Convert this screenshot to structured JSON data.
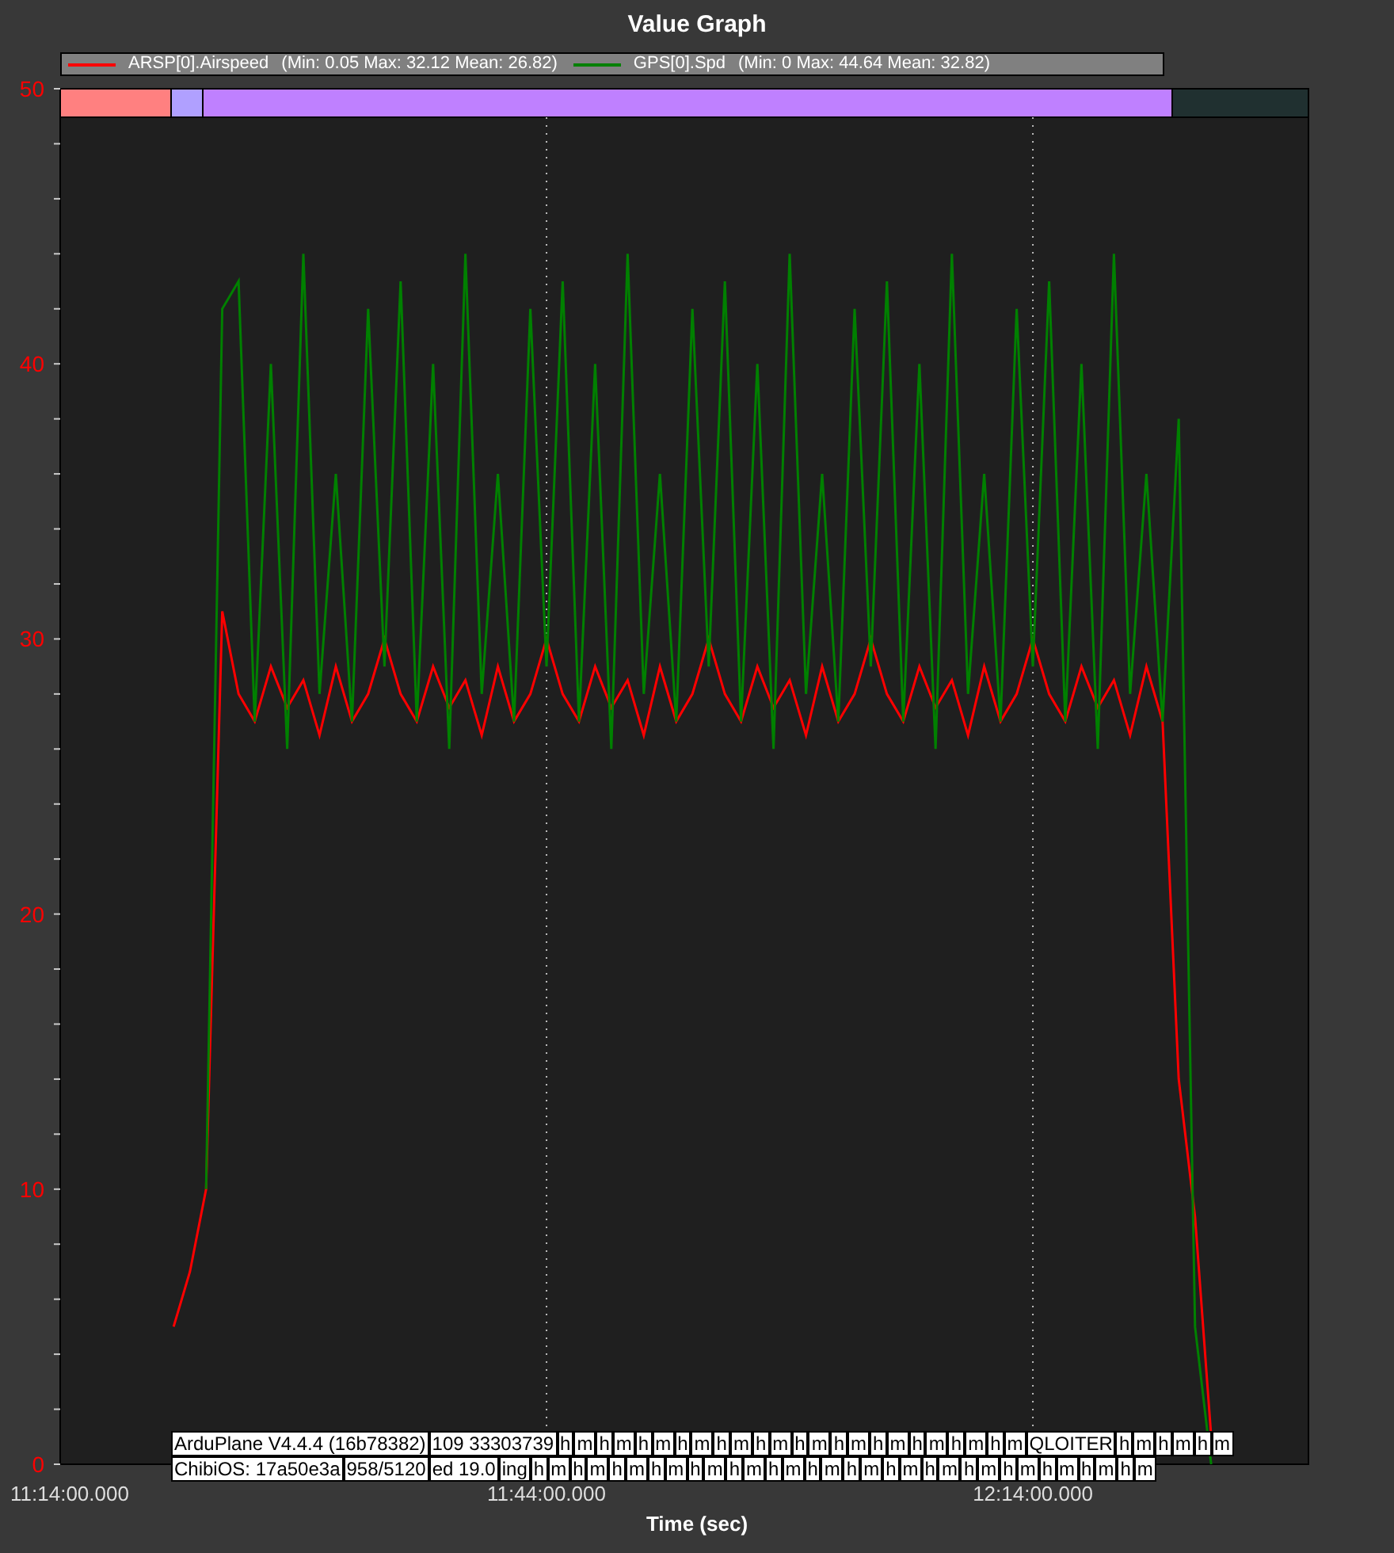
{
  "title": "Value Graph",
  "legend": [
    {
      "stats": "(Min: 0.05 Max: 32.12 Mean: 26.82)"
    },
    {
      "stats": "(Min: 0 Max: 44.64 Mean: 32.82)"
    }
  ],
  "chart_data": {
    "type": "line",
    "xlabel": "Time (sec)",
    "ylim": [
      0,
      50
    ],
    "yticks": [
      0,
      10,
      20,
      30,
      40,
      50
    ],
    "categories": [
      "11:14:00.000",
      null,
      null,
      null,
      null,
      null,
      null,
      null,
      null,
      null,
      null,
      null,
      null,
      null,
      null,
      null,
      null,
      null,
      null,
      null,
      null,
      null,
      null,
      null,
      null,
      null,
      null,
      null,
      null,
      null,
      "11:44:00.000",
      null,
      null,
      null,
      null,
      null,
      null,
      null,
      null,
      null,
      null,
      null,
      null,
      null,
      null,
      null,
      null,
      null,
      null,
      null,
      null,
      null,
      null,
      null,
      null,
      null,
      null,
      null,
      null,
      null,
      "12:14:00.000",
      null,
      null,
      null,
      null,
      null,
      null,
      null,
      null,
      null,
      null,
      null,
      null,
      null,
      null,
      null,
      null,
      null
    ],
    "series": [
      {
        "name": "ARSP[0].Airspeed",
        "color": "#ff0000",
        "values": [
          null,
          null,
          null,
          null,
          null,
          null,
          null,
          5,
          7,
          10,
          31,
          28,
          27,
          29,
          27.5,
          28.5,
          26.5,
          29,
          27,
          28,
          30,
          28,
          27,
          29,
          27.5,
          28.5,
          26.5,
          29,
          27,
          28,
          30,
          28,
          27,
          29,
          27.5,
          28.5,
          26.5,
          29,
          27,
          28,
          30,
          28,
          27,
          29,
          27.5,
          28.5,
          26.5,
          29,
          27,
          28,
          30,
          28,
          27,
          29,
          27.5,
          28.5,
          26.5,
          29,
          27,
          28,
          30,
          28,
          27,
          29,
          27.5,
          28.5,
          26.5,
          29,
          27,
          14,
          9,
          1,
          null,
          null,
          null,
          null,
          null,
          null
        ]
      },
      {
        "name": "GPS[0].Spd",
        "color": "#008000",
        "values": [
          null,
          null,
          null,
          null,
          null,
          null,
          null,
          null,
          null,
          10,
          42,
          43,
          27,
          40,
          26,
          44,
          28,
          36,
          27,
          42,
          29,
          43,
          27,
          40,
          26,
          44,
          28,
          36,
          27,
          42,
          29,
          43,
          27,
          40,
          26,
          44,
          28,
          36,
          27,
          42,
          29,
          43,
          27,
          40,
          26,
          44,
          28,
          36,
          27,
          42,
          29,
          43,
          27,
          40,
          26,
          44,
          28,
          36,
          27,
          42,
          29,
          43,
          27,
          40,
          26,
          44,
          28,
          36,
          27,
          38,
          5,
          0,
          null,
          null,
          null,
          null,
          null,
          null
        ]
      }
    ]
  },
  "messages": [
    [
      "ArduPlane V4.4.4 (16b78382)",
      "109 33303739",
      "h",
      "m",
      "h",
      "m",
      "h",
      "m",
      "h",
      "m",
      "h",
      "m",
      "h",
      "m",
      "h",
      "m",
      "h",
      "m",
      "h",
      "m",
      "h",
      "m",
      "h",
      "m",
      "h",
      "m",
      "QLOITER",
      "h",
      "m",
      "h",
      "m",
      "h",
      "m"
    ],
    [
      "ChibiOS: 17a50e3a",
      "958/5120",
      "ed 19.0",
      "ing",
      "h",
      "m",
      "h",
      "m",
      "h",
      "m",
      "h",
      "m",
      "h",
      "m",
      "h",
      "m",
      "h",
      "m",
      "h",
      "m",
      "h",
      "m",
      "h",
      "m",
      "h",
      "m",
      "h",
      "m",
      "h",
      "m",
      "h",
      "m",
      "h",
      "m",
      "h",
      "m"
    ]
  ]
}
